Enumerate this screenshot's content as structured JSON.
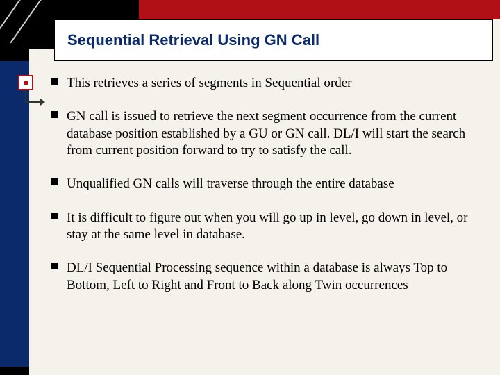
{
  "title": "Sequential Retrieval Using GN Call",
  "bullets": [
    "This retrieves a series of segments in Sequential order",
    "GN call is issued to retrieve the next segment occurrence from the current database position established by a GU or GN call. DL/I will start the search from current position forward to try to satisfy the call.",
    "Unqualified GN calls will traverse through the entire database",
    "It is difficult to figure out when you will go up in level, go down in level, or stay at the same level in database.",
    "DL/I Sequential Processing sequence within a database is always Top to Bottom, Left to Right and Front to Back along Twin occurrences"
  ]
}
